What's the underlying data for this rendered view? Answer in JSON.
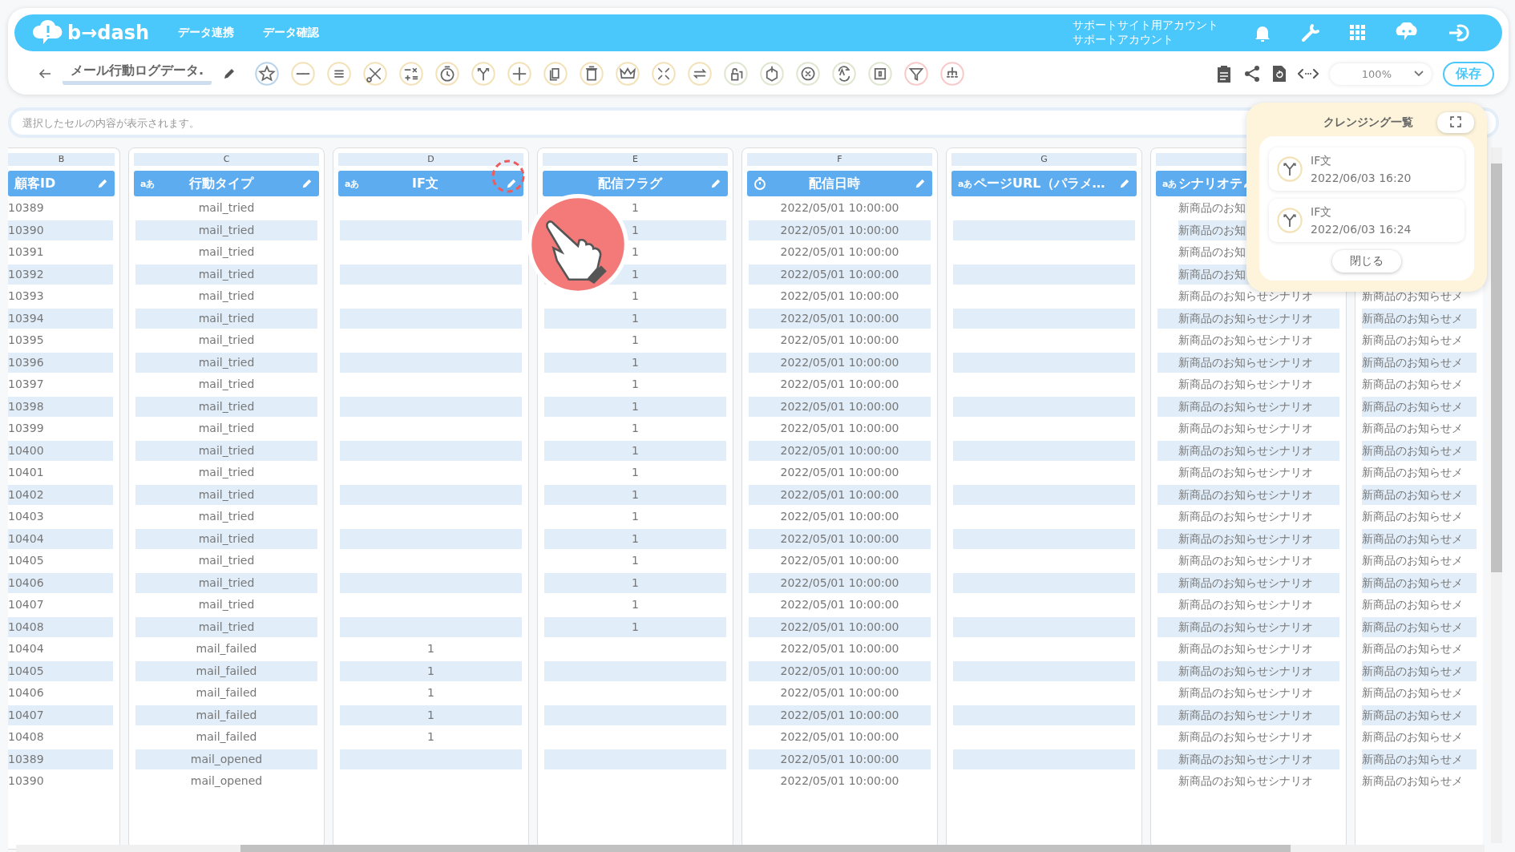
{
  "header": {
    "logo": "b→dash",
    "nav": [
      {
        "label": "データ連携"
      },
      {
        "label": "データ確認"
      }
    ],
    "account": [
      "サポートサイト用アカウント",
      "サポートアカウント"
    ]
  },
  "toolbar": {
    "title": "メール行動ログデータ.",
    "tools": [
      {
        "kind": "star",
        "color": "#b9d3ea"
      },
      {
        "kind": "dots",
        "color": "#f3e2b8"
      },
      {
        "kind": "lines",
        "color": "#f3e2b8"
      },
      {
        "kind": "scissors",
        "color": "#f3e2b8"
      },
      {
        "kind": "calc",
        "color": "#f3e2b8"
      },
      {
        "kind": "timer",
        "color": "#f3e2b8"
      },
      {
        "kind": "branch",
        "color": "#f3e2b8"
      },
      {
        "kind": "plus",
        "color": "#f3e2b8"
      },
      {
        "kind": "copy",
        "color": "#f3e2b8"
      },
      {
        "kind": "trash",
        "color": "#f3e2b8"
      },
      {
        "kind": "crown",
        "color": "#f3e2b8"
      },
      {
        "kind": "shrink",
        "color": "#f3e2b8"
      },
      {
        "kind": "loop",
        "color": "#f3e2b8"
      },
      {
        "kind": "lock",
        "color": "#dfe6cf"
      },
      {
        "kind": "box",
        "color": "#dfe6cf"
      },
      {
        "kind": "cross",
        "color": "#dfe6cf"
      },
      {
        "kind": "swap",
        "color": "#dfe6cf"
      },
      {
        "kind": "zero",
        "color": "#dfe6cf"
      },
      {
        "kind": "filter",
        "color": "#f7c9c9"
      },
      {
        "kind": "tree",
        "color": "#f7c9c9"
      }
    ],
    "zoom": "100%",
    "save": "保存"
  },
  "cell_bar": {
    "placeholder": "選択したセルの内容が表示されます。"
  },
  "columns": [
    {
      "letter": "B",
      "title": "顧客ID",
      "kind": "none"
    },
    {
      "letter": "C",
      "title": "行動タイプ",
      "kind": "text",
      "type_label": "aあ"
    },
    {
      "letter": "D",
      "title": "IF文",
      "kind": "text",
      "type_label": "aあ"
    },
    {
      "letter": "E",
      "title": "配信フラグ",
      "kind": "none"
    },
    {
      "letter": "F",
      "title": "配信日時",
      "kind": "clock"
    },
    {
      "letter": "G",
      "title": "ページURL（パラメ…",
      "kind": "text",
      "type_label": "aあ"
    },
    {
      "title": "シナリオテ",
      "kind": "text",
      "type_label": "aあ"
    },
    {
      "kind": "none"
    }
  ],
  "rows": [
    {
      "cells": [
        "10389",
        "mail_tried",
        null,
        "1",
        "2022/05/01 10:00:00",
        null,
        "新商品のお知",
        null
      ]
    },
    {
      "cells": [
        "10390",
        "mail_tried",
        null,
        "1",
        "2022/05/01 10:00:00",
        null,
        "新商品のお知",
        null
      ]
    },
    {
      "cells": [
        "10391",
        "mail_tried",
        null,
        "1",
        "2022/05/01 10:00:00",
        null,
        "新商品のお知",
        null
      ]
    },
    {
      "cells": [
        "10392",
        "mail_tried",
        null,
        "1",
        "2022/05/01 10:00:00",
        null,
        "新商品のお知",
        null
      ]
    },
    {
      "cells": [
        "10393",
        "mail_tried",
        null,
        "1",
        "2022/05/01 10:00:00",
        null,
        "新商品のお知らせシナリオ",
        "新商品のお知らせメ"
      ]
    },
    {
      "cells": [
        "10394",
        "mail_tried",
        null,
        "1",
        "2022/05/01 10:00:00",
        null,
        "新商品のお知らせシナリオ",
        "新商品のお知らせメ"
      ]
    },
    {
      "cells": [
        "10395",
        "mail_tried",
        null,
        "1",
        "2022/05/01 10:00:00",
        null,
        "新商品のお知らせシナリオ",
        "新商品のお知らせメ"
      ]
    },
    {
      "cells": [
        "10396",
        "mail_tried",
        null,
        "1",
        "2022/05/01 10:00:00",
        null,
        "新商品のお知らせシナリオ",
        "新商品のお知らせメ"
      ]
    },
    {
      "cells": [
        "10397",
        "mail_tried",
        null,
        "1",
        "2022/05/01 10:00:00",
        null,
        "新商品のお知らせシナリオ",
        "新商品のお知らせメ"
      ]
    },
    {
      "cells": [
        "10398",
        "mail_tried",
        null,
        "1",
        "2022/05/01 10:00:00",
        null,
        "新商品のお知らせシナリオ",
        "新商品のお知らせメ"
      ]
    },
    {
      "cells": [
        "10399",
        "mail_tried",
        null,
        "1",
        "2022/05/01 10:00:00",
        null,
        "新商品のお知らせシナリオ",
        "新商品のお知らせメ"
      ]
    },
    {
      "cells": [
        "10400",
        "mail_tried",
        null,
        "1",
        "2022/05/01 10:00:00",
        null,
        "新商品のお知らせシナリオ",
        "新商品のお知らせメ"
      ]
    },
    {
      "cells": [
        "10401",
        "mail_tried",
        null,
        "1",
        "2022/05/01 10:00:00",
        null,
        "新商品のお知らせシナリオ",
        "新商品のお知らせメ"
      ]
    },
    {
      "cells": [
        "10402",
        "mail_tried",
        null,
        "1",
        "2022/05/01 10:00:00",
        null,
        "新商品のお知らせシナリオ",
        "新商品のお知らせメ"
      ]
    },
    {
      "cells": [
        "10403",
        "mail_tried",
        null,
        "1",
        "2022/05/01 10:00:00",
        null,
        "新商品のお知らせシナリオ",
        "新商品のお知らせメ"
      ]
    },
    {
      "cells": [
        "10404",
        "mail_tried",
        null,
        "1",
        "2022/05/01 10:00:00",
        null,
        "新商品のお知らせシナリオ",
        "新商品のお知らせメ"
      ]
    },
    {
      "cells": [
        "10405",
        "mail_tried",
        null,
        "1",
        "2022/05/01 10:00:00",
        null,
        "新商品のお知らせシナリオ",
        "新商品のお知らせメ"
      ]
    },
    {
      "cells": [
        "10406",
        "mail_tried",
        null,
        "1",
        "2022/05/01 10:00:00",
        null,
        "新商品のお知らせシナリオ",
        "新商品のお知らせメ"
      ]
    },
    {
      "cells": [
        "10407",
        "mail_tried",
        null,
        "1",
        "2022/05/01 10:00:00",
        null,
        "新商品のお知らせシナリオ",
        "新商品のお知らせメ"
      ]
    },
    {
      "cells": [
        "10408",
        "mail_tried",
        null,
        "1",
        "2022/05/01 10:00:00",
        null,
        "新商品のお知らせシナリオ",
        "新商品のお知らせメ"
      ]
    },
    {
      "cells": [
        "10404",
        "mail_failed",
        "1",
        null,
        "2022/05/01 10:00:00",
        null,
        "新商品のお知らせシナリオ",
        "新商品のお知らせメ"
      ]
    },
    {
      "cells": [
        "10405",
        "mail_failed",
        "1",
        null,
        "2022/05/01 10:00:00",
        null,
        "新商品のお知らせシナリオ",
        "新商品のお知らせメ"
      ]
    },
    {
      "cells": [
        "10406",
        "mail_failed",
        "1",
        null,
        "2022/05/01 10:00:00",
        null,
        "新商品のお知らせシナリオ",
        "新商品のお知らせメ"
      ]
    },
    {
      "cells": [
        "10407",
        "mail_failed",
        "1",
        null,
        "2022/05/01 10:00:00",
        null,
        "新商品のお知らせシナリオ",
        "新商品のお知らせメ"
      ]
    },
    {
      "cells": [
        "10408",
        "mail_failed",
        "1",
        null,
        "2022/05/01 10:00:00",
        null,
        "新商品のお知らせシナリオ",
        "新商品のお知らせメ"
      ]
    },
    {
      "cells": [
        "10389",
        "mail_opened",
        null,
        null,
        "2022/05/01 10:00:00",
        null,
        "新商品のお知らせシナリオ",
        "新商品のお知らせメ"
      ]
    },
    {
      "cells": [
        "10390",
        "mail_opened",
        null,
        null,
        "2022/05/01 10:00:00",
        null,
        "新商品のお知らせシナリオ",
        "新商品のお知らせメ"
      ]
    }
  ],
  "cleansing_panel": {
    "title": "クレンジング一覧",
    "items": [
      {
        "name": "IF文",
        "time": "2022/06/03 16:20"
      },
      {
        "name": "IF文",
        "time": "2022/06/03 16:24"
      }
    ],
    "close": "閉じる"
  }
}
